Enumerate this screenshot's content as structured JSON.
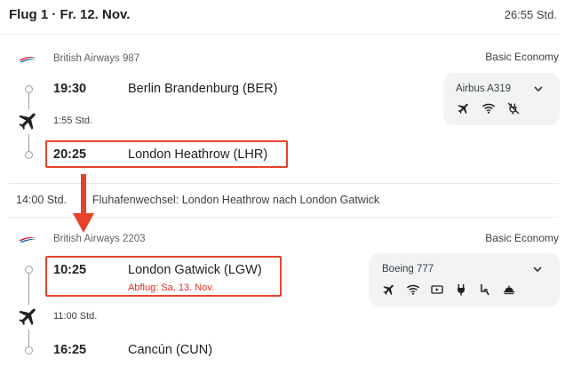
{
  "header": {
    "title": "Flug 1 · Fr. 12. Nov.",
    "total_duration": "26:55 Std."
  },
  "segments": [
    {
      "airline": "British Airways 987",
      "fare": "Basic Economy",
      "departure_time": "19:30",
      "departure_airport": "Berlin Brandenburg (BER)",
      "duration": "1:55 Std.",
      "arrival_time": "20:25",
      "arrival_airport": "London Heathrow (LHR)",
      "aircraft": "Airbus A319",
      "amenities": [
        "plane-icon",
        "wifi-icon",
        "no-power-icon"
      ]
    },
    {
      "airline": "British Airways 2203",
      "fare": "Basic Economy",
      "departure_time": "10:25",
      "departure_airport": "London Gatwick (LGW)",
      "departure_note": "Abflug: Sa. 13. Nov.",
      "duration": "11:00 Std.",
      "arrival_time": "16:25",
      "arrival_airport": "Cancún (CUN)",
      "aircraft": "Boeing 777",
      "amenities": [
        "plane-icon",
        "wifi-icon",
        "video-icon",
        "power-icon",
        "legroom-icon",
        "meal-icon"
      ]
    }
  ],
  "layover": {
    "duration": "14:00 Std.",
    "text": "Fluhafenwechsel: London Heathrow nach London Gatwick"
  },
  "colors": {
    "highlight": "#e8422c",
    "note_red": "#d93025",
    "card_bg": "#f1f3f4"
  }
}
